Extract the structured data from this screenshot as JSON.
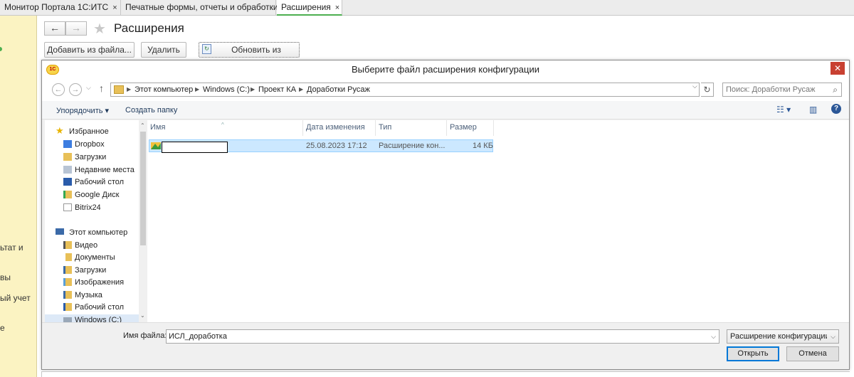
{
  "tabs": [
    {
      "label": "Монитор Портала 1С:ИТС",
      "close": "×"
    },
    {
      "label": "Печатные формы, отчеты и обработки",
      "close": "×"
    },
    {
      "label": "Расширения",
      "close": "×"
    }
  ],
  "left_panel": {
    "items": [
      "ьтат и",
      "вы",
      "ый учет",
      "е"
    ]
  },
  "page": {
    "title": "Расширения",
    "back": "←",
    "forward": "→",
    "star": "★",
    "buttons": {
      "add_from_file": "Добавить из файла...",
      "delete": "Удалить",
      "update_from_file": "Обновить из файла..."
    }
  },
  "dialog": {
    "logo": "1С",
    "title": "Выберите файл расширения конфигурации",
    "close": "✕",
    "nav": {
      "back": "←",
      "forward": "→",
      "dropdown": "⌵",
      "up": "↑"
    },
    "breadcrumbs": [
      "Этот компьютер",
      "Windows (C:)",
      "Проект КА",
      "Доработки Русаж"
    ],
    "search_placeholder": "Поиск: Доработки Русаж",
    "commands": {
      "organize": "Упорядочить ▾",
      "new_folder": "Создать папку",
      "view_icon": "☷ ▾",
      "pane_icon": "▥",
      "help_icon": "?"
    },
    "nav_pane": {
      "favorites": {
        "label": "Избранное",
        "items": [
          "Dropbox",
          "Загрузки",
          "Недавние места",
          "Рабочий стол",
          "Google Диск",
          "Bitrix24"
        ]
      },
      "computer": {
        "label": "Этот компьютер",
        "items": [
          "Видео",
          "Документы",
          "Загрузки",
          "Изображения",
          "Музыка",
          "Рабочий стол",
          "Windows (C:)"
        ]
      }
    },
    "columns": {
      "name": "Имя",
      "date": "Дата изменения",
      "type": "Тип",
      "size": "Размер"
    },
    "files": [
      {
        "name": "",
        "date": "25.08.2023 17:12",
        "type": "Расширение кон...",
        "size": "14 КБ"
      }
    ],
    "filename_label": "Имя файла:",
    "filename_value": "ИСЛ_доработка",
    "filter_value": "Расширение конфигурации (*",
    "open_button": "Открыть",
    "cancel_button": "Отмена"
  },
  "colors": {
    "accent_green": "#4caf50",
    "selection": "#cce8ff",
    "left_panel": "#fbf3c2",
    "close_red": "#c84031"
  }
}
